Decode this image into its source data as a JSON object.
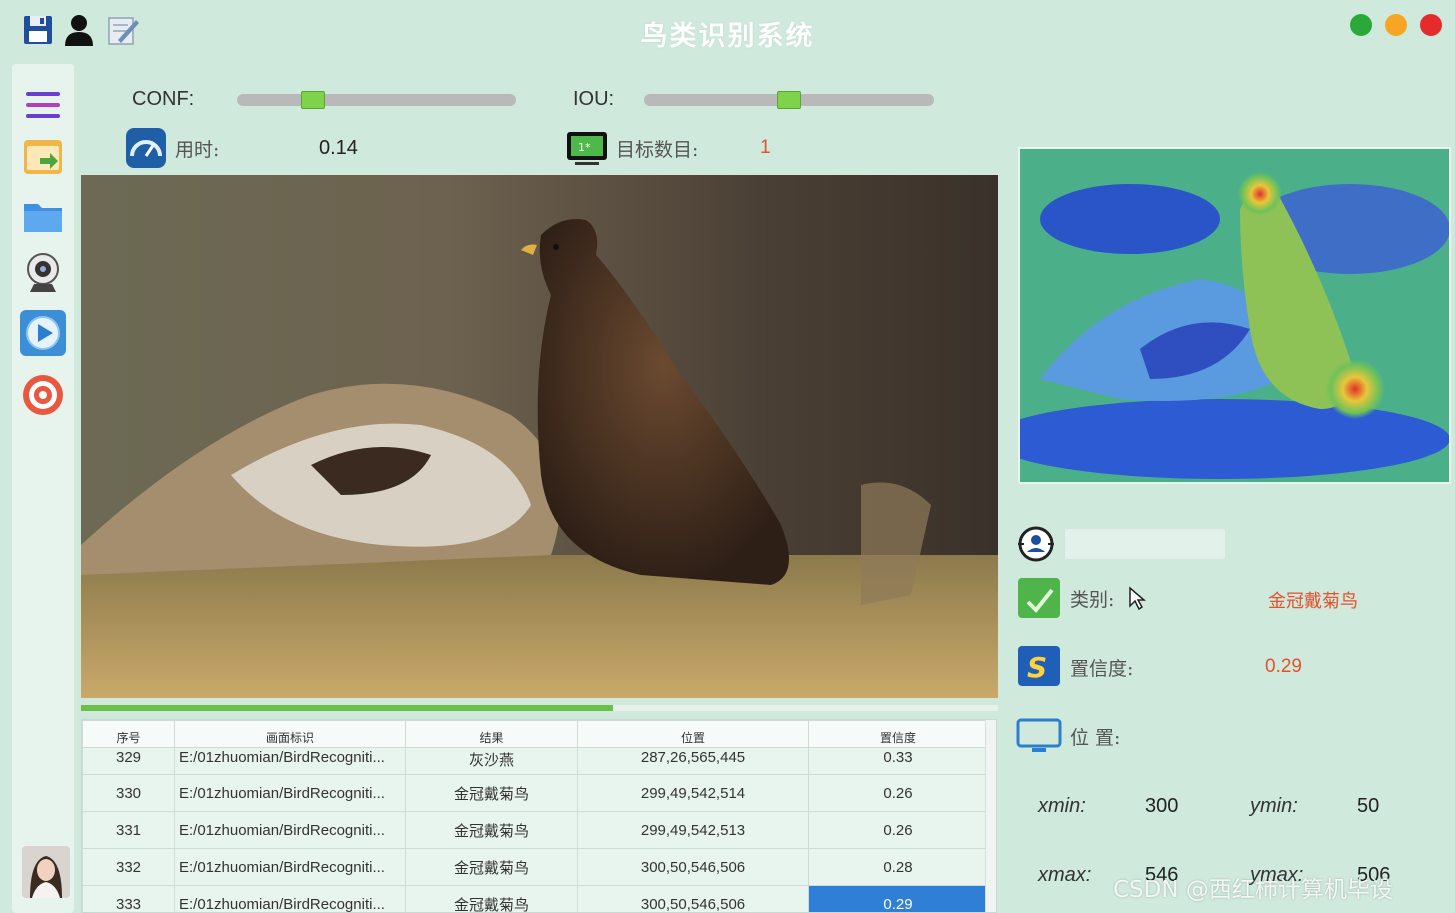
{
  "window": {
    "title": "鸟类识别系统",
    "icons": [
      "save-icon",
      "user-icon",
      "edit-icon"
    ],
    "controls": [
      "minimize-dot",
      "maximize-dot",
      "close-dot"
    ],
    "colors": {
      "green_dot": "#2aa838",
      "yellow_dot": "#f6a623",
      "red_dot": "#e52b2b"
    }
  },
  "sidebar": {
    "items": [
      "menu-icon",
      "open-image-icon",
      "folder-icon",
      "webcam-icon",
      "video-play-icon",
      "target-icon"
    ],
    "avatar": "avatar"
  },
  "controls": {
    "conf_label": "CONF:",
    "conf_value": 0.25,
    "iou_label": "IOU:",
    "iou_value": 0.5,
    "time_label": "用时:",
    "time_value": "0.14",
    "count_label": "目标数目:",
    "count_value": "1"
  },
  "progress": 0.58,
  "table": {
    "headers": [
      "序号",
      "画面标识",
      "结果",
      "位置",
      "置信度"
    ],
    "rows": [
      [
        "329",
        "E:/01zhuomian/BirdRecogniti...",
        "灰沙燕",
        "287,26,565,445",
        "0.33"
      ],
      [
        "330",
        "E:/01zhuomian/BirdRecogniti...",
        "金冠戴菊鸟",
        "299,49,542,514",
        "0.26"
      ],
      [
        "331",
        "E:/01zhuomian/BirdRecogniti...",
        "金冠戴菊鸟",
        "299,49,542,513",
        "0.26"
      ],
      [
        "332",
        "E:/01zhuomian/BirdRecogniti...",
        "金冠戴菊鸟",
        "300,50,546,506",
        "0.28"
      ],
      [
        "333",
        "E:/01zhuomian/BirdRecogniti...",
        "金冠戴菊鸟",
        "300,50,546,506",
        "0.29"
      ]
    ],
    "selected_row": 4
  },
  "info": {
    "target_select_icon": "target-select-icon",
    "class_label": "类别:",
    "class_value": "金冠戴菊鸟",
    "conf_label": "置信度:",
    "conf_value": "0.29",
    "position_label": "位 置:",
    "xmin_label": "xmin:",
    "xmin_value": "300",
    "ymin_label": "ymin:",
    "ymin_value": "50",
    "xmax_label": "xmax:",
    "xmax_value": "546",
    "ymax_label": "ymax:",
    "ymax_value": "506"
  },
  "watermark": "CSDN @西红柿计算机毕设"
}
